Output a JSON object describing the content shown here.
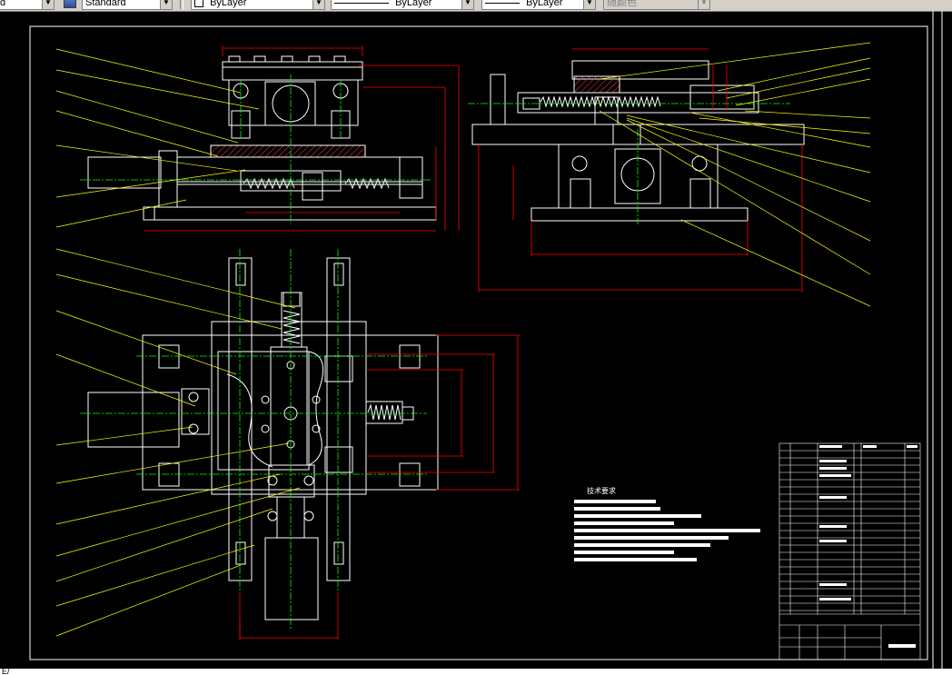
{
  "toolbar": {
    "text_style_partial": "d",
    "dim_style": "Standard",
    "layer": "ByLayer",
    "linetype": "ByLayer",
    "lineweight": "ByLayer",
    "plot_style": "随颜色"
  },
  "notes": {
    "heading": "技术要求"
  },
  "command_line": {
    "text": "E/"
  },
  "colors": {
    "background": "#000000",
    "frame": "#ffffff",
    "dimension": "#ff0000",
    "centerline": "#00ff00",
    "leader": "#ffff00",
    "part": "#ffffff",
    "hatch": "#ff4040"
  }
}
